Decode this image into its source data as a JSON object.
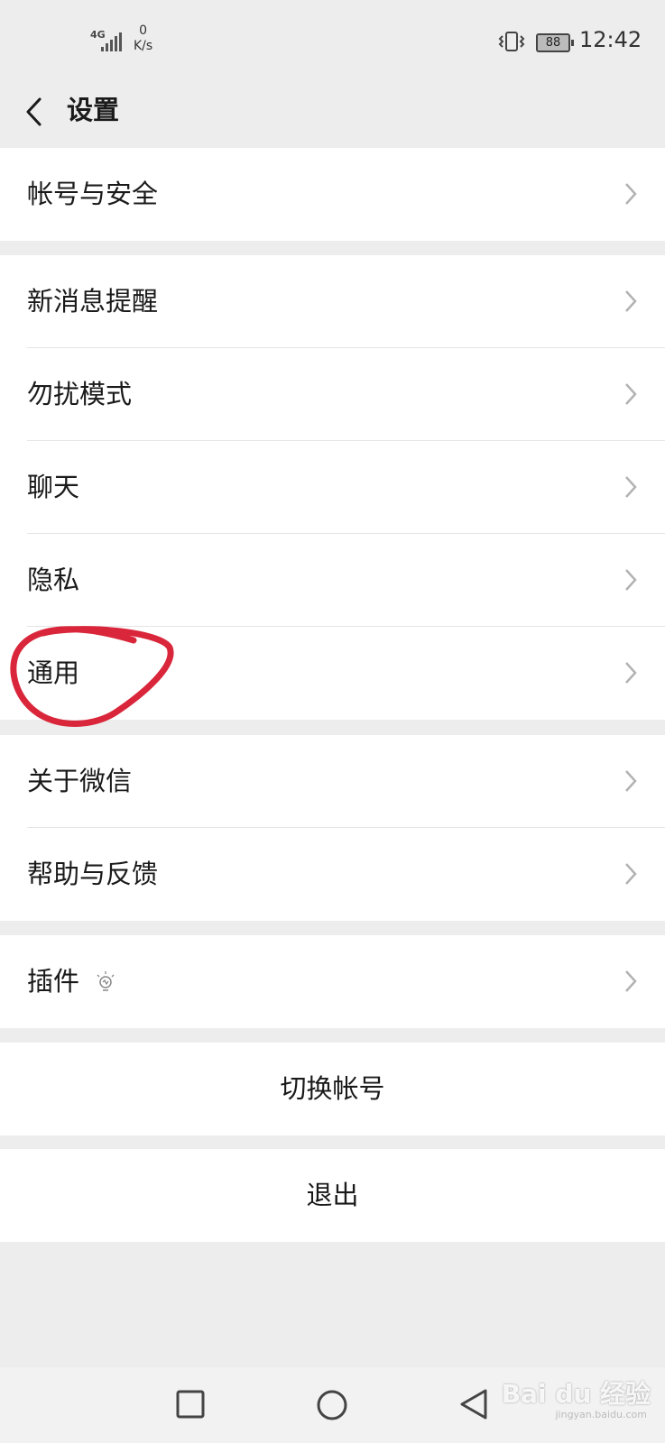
{
  "status_bar": {
    "network": "4G",
    "speed_value": "0",
    "speed_unit": "K/s",
    "battery": "88",
    "time": "12:42"
  },
  "header": {
    "title": "设置"
  },
  "groups": [
    {
      "items": [
        {
          "label": "帐号与安全"
        }
      ]
    },
    {
      "items": [
        {
          "label": "新消息提醒"
        },
        {
          "label": "勿扰模式"
        },
        {
          "label": "聊天"
        },
        {
          "label": "隐私"
        },
        {
          "label": "通用"
        }
      ]
    },
    {
      "items": [
        {
          "label": "关于微信"
        },
        {
          "label": "帮助与反馈"
        }
      ]
    },
    {
      "items": [
        {
          "label": "插件"
        }
      ]
    }
  ],
  "actions": {
    "switch_account": "切换帐号",
    "logout": "退出"
  },
  "watermark": {
    "brand": "Bai du 经验",
    "url": "jingyan.baidu.com"
  },
  "colors": {
    "annotation": "#d9263a",
    "background": "#ededed"
  }
}
